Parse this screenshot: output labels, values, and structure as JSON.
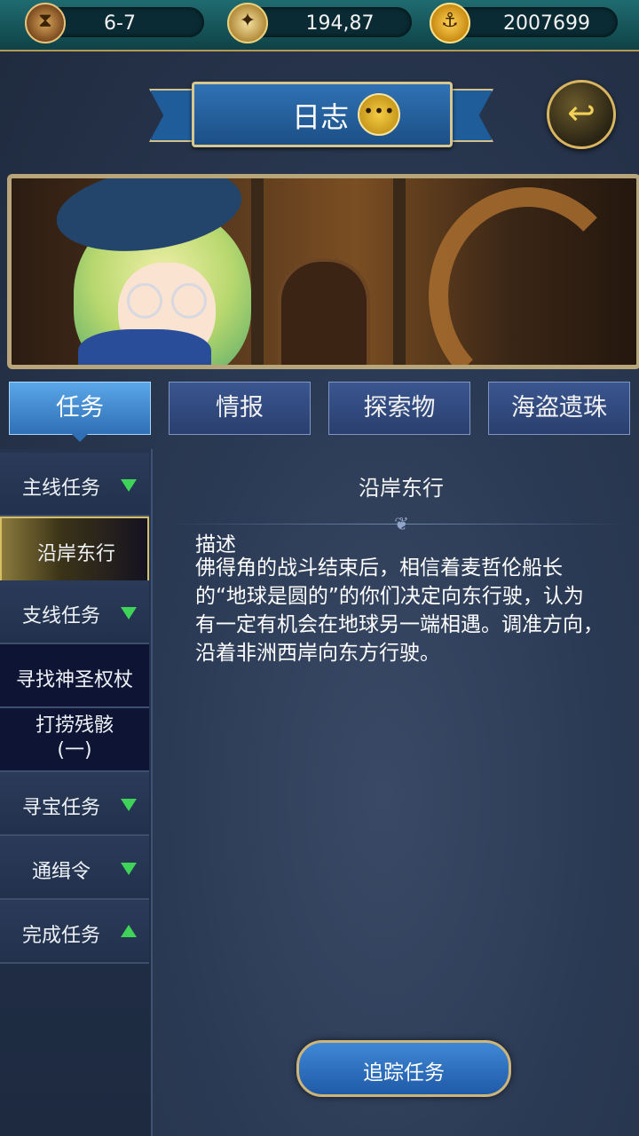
{
  "status": {
    "turns": "6-7",
    "compass_value": "194,87",
    "gold": "2007699",
    "icons": [
      "hourglass-icon",
      "compass-icon",
      "anchor-coin-icon"
    ]
  },
  "header": {
    "title": "日志",
    "back_icon": "back-arrow-icon"
  },
  "tabs": [
    {
      "label": "任务",
      "active": true
    },
    {
      "label": "情报",
      "active": false
    },
    {
      "label": "探索物",
      "active": false
    },
    {
      "label": "海盗遗珠",
      "active": false
    }
  ],
  "sidebar": {
    "items": [
      {
        "label": "主线任务",
        "type": "category",
        "expanded": true
      },
      {
        "label": "沿岸东行",
        "type": "quest",
        "selected": true
      },
      {
        "label": "支线任务",
        "type": "category",
        "expanded": true
      },
      {
        "label": "寻找神圣权杖",
        "type": "quest"
      },
      {
        "label": "打捞残骸\n(一)",
        "type": "quest"
      },
      {
        "label": "寻宝任务",
        "type": "category",
        "expanded": true
      },
      {
        "label": "通缉令",
        "type": "category",
        "expanded": true
      },
      {
        "label": "完成任务",
        "type": "category",
        "expanded": false
      }
    ]
  },
  "content": {
    "title": "沿岸东行",
    "desc_label": "描述",
    "desc_text": "佛得角的战斗结束后，相信着麦哲伦船长的“地球是圆的”的你们决定向东行驶，认为有一定有机会在地球另一端相遇。调准方向，沿着非洲西岸向东方行驶。"
  },
  "actions": {
    "track_label": "追踪任务"
  },
  "colors": {
    "accent": "#2f6fb5",
    "gold_border": "#d8c690",
    "expand_arrow": "#3fd35a"
  }
}
